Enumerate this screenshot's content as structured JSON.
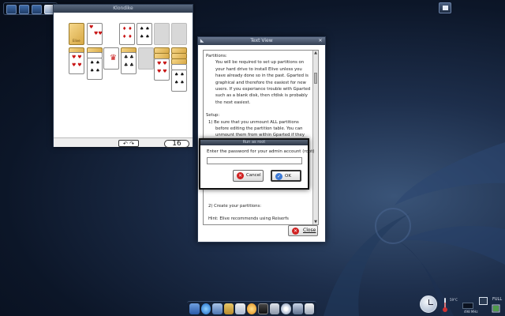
{
  "solitaire": {
    "title": "Klondike",
    "undo_label": "↶ ↷",
    "card_count": "16",
    "stock_label": "Elive"
  },
  "text_view": {
    "title": "Text View",
    "lines": [
      {
        "text": "Partitions:",
        "indent": 0
      },
      {
        "text": "You will be required to set up partitions on",
        "indent": 1
      },
      {
        "text": "your hard drive to install Elive unless you",
        "indent": 1
      },
      {
        "text": "have already done so in the past. Gparted is",
        "indent": 1
      },
      {
        "text": "graphical and therefore the easiest for new",
        "indent": 1
      },
      {
        "text": "users. If you experiance trouble with Gparted",
        "indent": 1
      },
      {
        "text": "such as a blank disk, then cfdisk is probably",
        "indent": 1
      },
      {
        "text": "the next easiest.",
        "indent": 1
      },
      {
        "text": "",
        "indent": 0
      },
      {
        "text": "Setup:",
        "indent": 0
      },
      {
        "text": "1)  Be sure that you unmount ALL partitions",
        "indent": 1
      },
      {
        "text": "before editing the partition table. You can",
        "indent": 2
      },
      {
        "text": "unmount them from within Gparted if they",
        "indent": 2
      }
    ],
    "lines_bottom": [
      {
        "text": "2)  Create your partitions:",
        "indent": 1
      },
      {
        "text": "",
        "indent": 0
      },
      {
        "text": "Hint: Elive recommends using Reiserfs",
        "indent": 1
      }
    ],
    "close_label": "Close"
  },
  "password_dialog": {
    "title": "Run as root",
    "prompt": "Enter the password for your admin account (root)",
    "password_value": "",
    "cancel_label": "Cancel",
    "ok_label": "OK"
  },
  "tray": {
    "temperature": "59°C",
    "cpu": "498 MHz",
    "battery_status": "FULL"
  },
  "dock": {
    "icons": [
      "monitor-icon",
      "browser-icon",
      "file-manager-icon",
      "folder-icon",
      "mail-icon",
      "chat-icon",
      "terminal-icon",
      "media-icon",
      "disc-icon",
      "network-icon",
      "printer-icon"
    ]
  },
  "colors": {
    "desktop_dark": "#070d1a",
    "desktop_light": "#3a5478",
    "titlebar": "#333f52",
    "red_suit": "#c81414",
    "close_red": "#d02020"
  }
}
